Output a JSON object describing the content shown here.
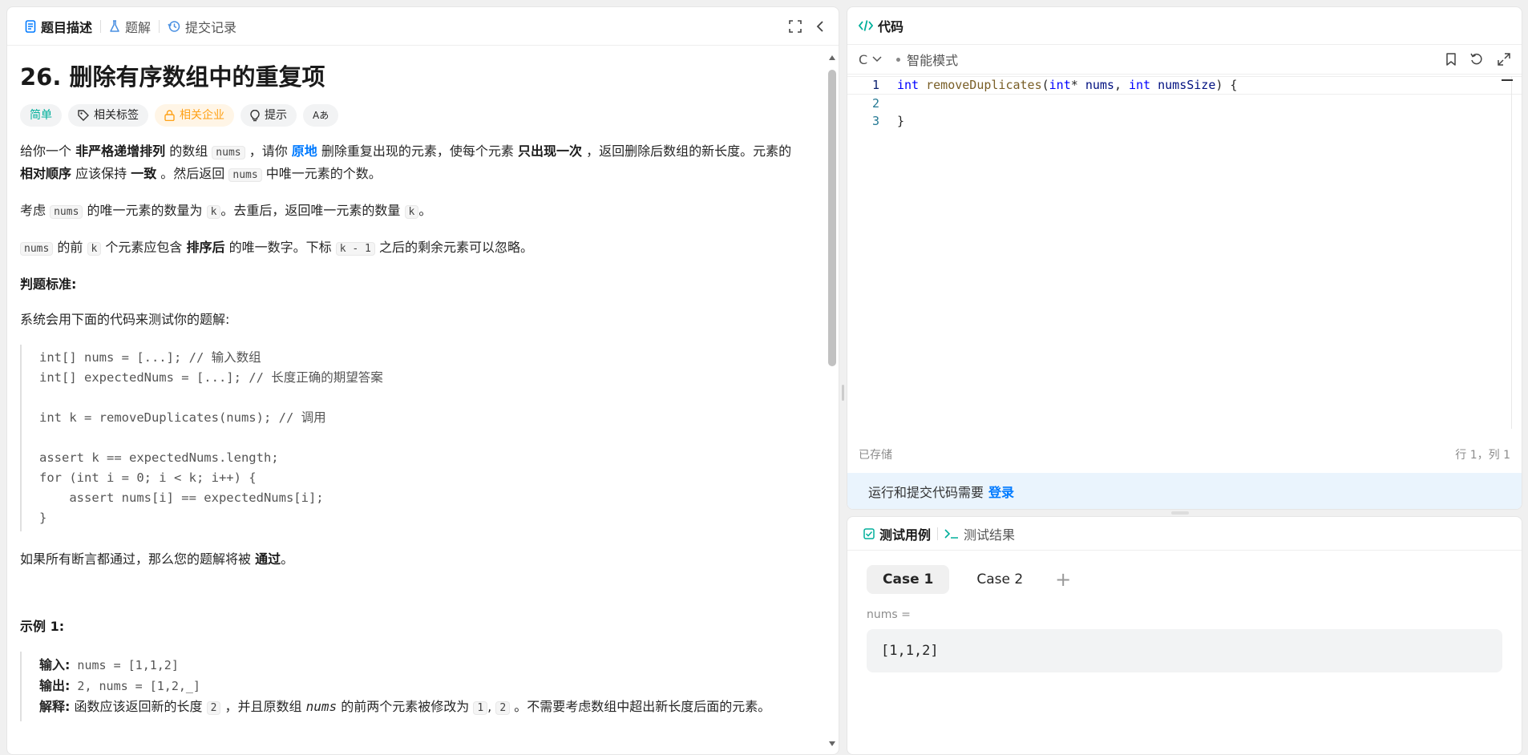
{
  "left": {
    "tabs": [
      {
        "label": "题目描述"
      },
      {
        "label": "题解"
      },
      {
        "label": "提交记录"
      }
    ],
    "title": "26. 删除有序数组中的重复项",
    "badges": {
      "difficulty": "简单",
      "tags": "相关标签",
      "company": "相关企业",
      "hint": "提示",
      "lang": "Aあ"
    },
    "p1": {
      "a": "给你一个 ",
      "b1": "非严格递增排列",
      "c": " 的数组 ",
      "code1": "nums",
      "d": " ，请你 ",
      "link": "原地",
      "e": " 删除重复出现的元素，使每个元素 ",
      "b2": "只出现一次",
      "f": " ，返回删除后数组的新长度。元素的 ",
      "b3": "相对顺序",
      "g": " 应该保持 ",
      "b4": "一致",
      "h": " 。然后返回 ",
      "code2": "nums",
      "i": " 中唯一元素的个数。"
    },
    "p2": {
      "a": "考虑 ",
      "code1": "nums",
      "b": " 的唯一元素的数量为 ",
      "code2": "k",
      "c": "。去重后，返回唯一元素的数量 ",
      "code3": "k",
      "d": "。"
    },
    "p3": {
      "code1": "nums",
      "a": " 的前 ",
      "code2": "k",
      "b": " 个元素应包含 ",
      "bold": "排序后",
      "c": " 的唯一数字。下标 ",
      "code3": "k - 1",
      "d": " 之后的剩余元素可以忽略。"
    },
    "judge_heading": "判题标准:",
    "judge_text": "系统会用下面的代码来测试你的题解:",
    "judge_code": "int[] nums = [...]; // 输入数组\nint[] expectedNums = [...]; // 长度正确的期望答案\n\nint k = removeDuplicates(nums); // 调用\n\nassert k == expectedNums.length;\nfor (int i = 0; i < k; i++) {\n    assert nums[i] == expectedNums[i];\n}",
    "pass_text": {
      "a": "如果所有断言都通过，那么您的题解将被 ",
      "bold": "通过",
      "b": "。"
    },
    "example_heading": "示例 1:",
    "example": {
      "input_label": "输入:",
      "input_value": " nums = [1,1,2]",
      "output_label": "输出:",
      "output_value": " 2, nums = [1,2,_]",
      "explain_label": "解释:",
      "explain_a": " 函数应该返回新的长度 ",
      "explain_code1": "2",
      "explain_b": " ，并且原数组 ",
      "explain_italic": "nums",
      "explain_c": " 的前两个元素被修改为 ",
      "explain_code2": "1",
      "explain_d": ", ",
      "explain_code3": "2",
      "explain_e": " 。不需要考虑数组中超出新长度后面的元素。"
    }
  },
  "code": {
    "title": "代码",
    "language": "C",
    "mode": "智能模式",
    "lines": [
      {
        "no": "1"
      },
      {
        "no": "2"
      },
      {
        "no": "3",
        "text": "}"
      }
    ],
    "line1": {
      "kw1": "int",
      "fn": "removeDuplicates",
      "p1": "(",
      "kw2": "int",
      "p2": "* ",
      "param1": "nums",
      "p3": ", ",
      "kw3": "int",
      "p4": " ",
      "param2": "numsSize",
      "p5": ") {"
    },
    "saved": "已存储",
    "cursor": "行 1，列 1",
    "login_prompt": "运行和提交代码需要",
    "login_link": "登录"
  },
  "testcase": {
    "tab_cases": "测试用例",
    "tab_result": "测试结果",
    "cases": [
      "Case 1",
      "Case 2"
    ],
    "add": "+",
    "input_label": "nums =",
    "input_value": "[1,1,2]"
  }
}
